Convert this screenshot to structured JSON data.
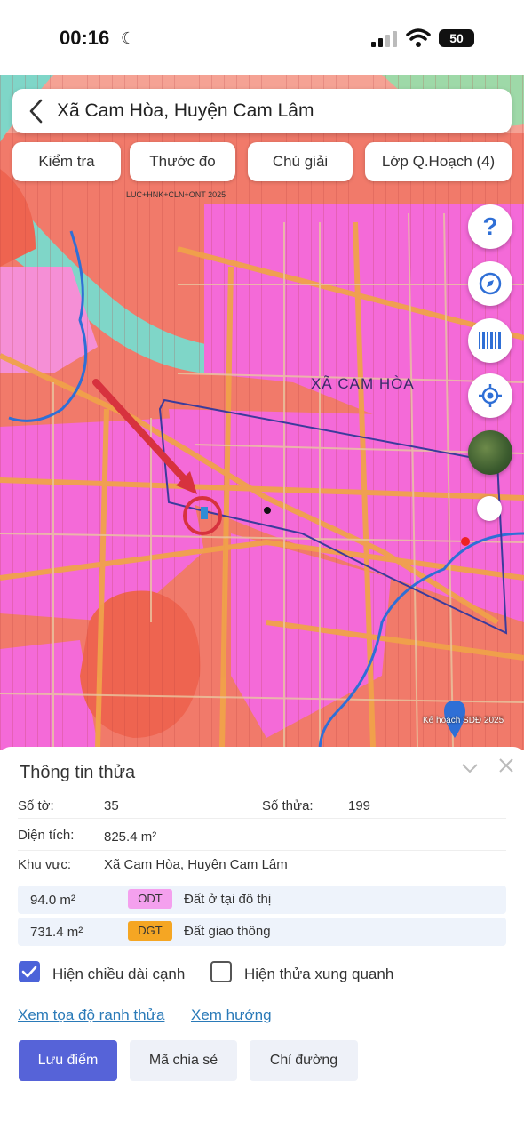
{
  "status": {
    "time": "00:16",
    "battery": "50"
  },
  "header": {
    "title": "Xã Cam Hòa, Huyện Cam Lâm"
  },
  "toolbar": {
    "check": "Kiểm tra",
    "measure": "Thước đo",
    "legend": "Chú giải",
    "layers": "Lớp Q.Hoạch (4)"
  },
  "map": {
    "commune_label": "XÃ CAM HÒA",
    "plan_badge": "Kế hoạch SDĐ 2025",
    "top_label": "LUC+HNK+CLN+ONT  2025",
    "colors": {
      "residential": "#f46ad8",
      "base": "#f17a6a",
      "road": "#f0a24a",
      "water": "#7fd6c8",
      "river": "#2f6fd6",
      "boundary": "#3b3b9c",
      "arrow": "#d7323e"
    }
  },
  "panel": {
    "title": "Thông tin thửa",
    "sheet_label": "Số tờ:",
    "sheet_value": "35",
    "parcel_label": "Số thửa:",
    "parcel_value": "199",
    "area_label": "Diện tích:",
    "area_value": "825.4 m²",
    "region_label": "Khu vực:",
    "region_value": "Xã Cam Hòa, Huyện Cam Lâm",
    "land_uses": [
      {
        "area": "94.0 m²",
        "code": "ODT",
        "desc": "Đất ở tại đô thị",
        "color": "#f4a0ee"
      },
      {
        "area": "731.4 m²",
        "code": "DGT",
        "desc": "Đất giao thông",
        "color": "#f5a623"
      }
    ],
    "show_edge_length": "Hiện chiều dài cạnh",
    "show_neighbors": "Hiện thửa xung quanh",
    "link_coords": "Xem tọa độ ranh thửa",
    "link_direction": "Xem hướng",
    "btn_save": "Lưu điểm",
    "btn_share": "Mã chia sẻ",
    "btn_route": "Chỉ đường"
  }
}
